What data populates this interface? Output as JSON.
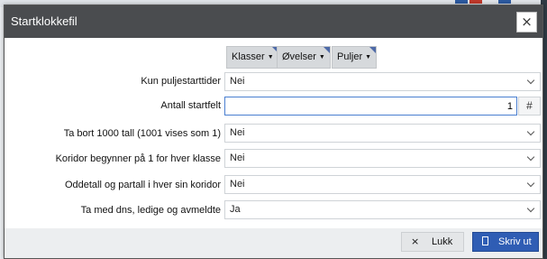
{
  "dialog": {
    "title": "Startklokkefil",
    "close_symbol": "×"
  },
  "filters": [
    {
      "label": "Klasser"
    },
    {
      "label": "Øvelser"
    },
    {
      "label": "Puljer"
    }
  ],
  "form": {
    "kun_puljestarttider": {
      "label": "Kun puljestarttider",
      "value": "Nei"
    },
    "antall_startfelt": {
      "label": "Antall startfelt",
      "value": "1",
      "hash_label": "#"
    },
    "ta_bort_1000": {
      "label": "Ta bort 1000 tall (1001 vises som 1)",
      "value": "Nei"
    },
    "koridor": {
      "label": "Koridor begynner på 1 for hver klasse",
      "value": "Nei"
    },
    "oddetall": {
      "label": "Oddetall og partall i hver sin koridor",
      "value": "Nei"
    },
    "ta_med_dns": {
      "label": "Ta med dns, ledige og avmeldte",
      "value": "Ja"
    }
  },
  "footer": {
    "close_label": "Lukk",
    "close_icon": "×",
    "print_label": "Skriv ut"
  },
  "colors": {
    "titlebar": "#4a4c4f",
    "primary_button": "#2f5db4",
    "filter_corner": "#4e6aa8",
    "focus_border": "#4a7fd0"
  }
}
